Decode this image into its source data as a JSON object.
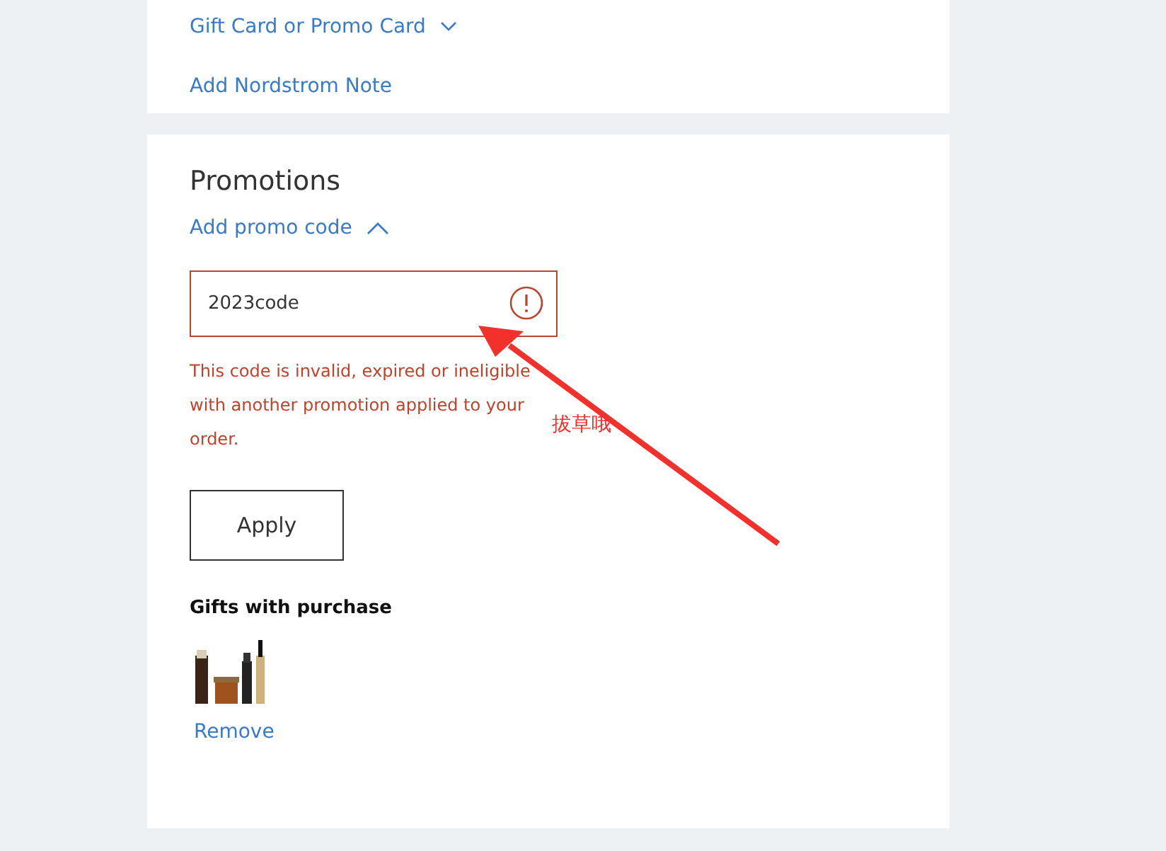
{
  "top_card": {
    "gift_card_link": "Gift Card or Promo Card",
    "note_link": "Add Nordstrom Note"
  },
  "promotions": {
    "title": "Promotions",
    "toggle": {
      "label": "Add promo code",
      "expanded": true
    },
    "code_field": {
      "value": "2023code",
      "invalid": true
    },
    "error": "This code is invalid, expired or ineligible with another promotion applied to your order.",
    "apply_button": "Apply",
    "gifts_heading": "Gifts with purchase",
    "remove_link": "Remove"
  },
  "annotation": {
    "text": "拔草哦"
  }
}
